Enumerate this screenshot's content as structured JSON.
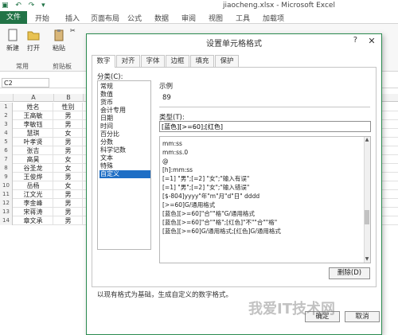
{
  "window": {
    "title": "jiaocheng.xlsx - Microsoft Excel",
    "accent": "#217346"
  },
  "ribbon_tabs": [
    "文件",
    "开始",
    "插入",
    "页面布局",
    "公式",
    "数据",
    "审阅",
    "视图",
    "工具",
    "加载项"
  ],
  "ribbon": {
    "new_label": "新建",
    "open_label": "打开",
    "paste_label": "粘贴",
    "group_common": "常用",
    "group_clipboard": "剪贴板"
  },
  "name_box": "C2",
  "columns": [
    "A",
    "B"
  ],
  "rows": [
    {
      "num": "1",
      "a": "姓名",
      "b": "性别"
    },
    {
      "num": "2",
      "a": "王高敏",
      "b": "男"
    },
    {
      "num": "3",
      "a": "李敏钰",
      "b": "男"
    },
    {
      "num": "4",
      "a": "慧琪",
      "b": "女"
    },
    {
      "num": "5",
      "a": "叶孝贤",
      "b": "男"
    },
    {
      "num": "6",
      "a": "张吉",
      "b": "男"
    },
    {
      "num": "7",
      "a": "高昊",
      "b": "女"
    },
    {
      "num": "8",
      "a": "谷圣龙",
      "b": "女"
    },
    {
      "num": "9",
      "a": "王俊烨",
      "b": "男"
    },
    {
      "num": "10",
      "a": "岳杨",
      "b": "女"
    },
    {
      "num": "11",
      "a": "江文光",
      "b": "男"
    },
    {
      "num": "12",
      "a": "李金峰",
      "b": "男"
    },
    {
      "num": "13",
      "a": "宋蒋涛",
      "b": "男"
    },
    {
      "num": "14",
      "a": "章文承",
      "b": "男"
    }
  ],
  "dialog": {
    "title": "设置单元格格式",
    "help": "?",
    "close": "✕",
    "tabs": [
      "数字",
      "对齐",
      "字体",
      "边框",
      "填充",
      "保护"
    ],
    "active_tab": "数字",
    "category_label": "分类(C):",
    "categories": [
      "常规",
      "数值",
      "货币",
      "会计专用",
      "日期",
      "时间",
      "百分比",
      "分数",
      "科学记数",
      "文本",
      "特殊",
      "自定义"
    ],
    "selected_category": "自定义",
    "sample_label": "示例",
    "sample_value": "89",
    "type_label": "类型(T):",
    "type_value": "[蓝色][>=60];[红色]",
    "format_list": [
      "mm:ss",
      "mm:ss.0",
      "@",
      "[h]:mm:ss",
      "[=1] \"男\";[=2] \"女\";\"输入有误\"",
      "[=1] \"男\";[=2] \"女\";\"输入错误\"",
      "[$-804]yyyy\"年\"m\"月\"d\"日\" dddd",
      "[>=60]G/通用格式",
      "[蓝色][>=60]\"合\"\"格\"G/通用格式",
      "[蓝色][>=60]\"合\"\"格\";[红色]\"不\"\"合\"\"格\"",
      "[蓝色][>=60]G/通用格式;[红色]G/通用格式"
    ],
    "delete_label": "删除(D)",
    "hint": "以现有格式为基础，生成自定义的数字格式。",
    "ok_label": "确定",
    "cancel_label": "取消"
  },
  "watermark": "我爱IT技术网"
}
